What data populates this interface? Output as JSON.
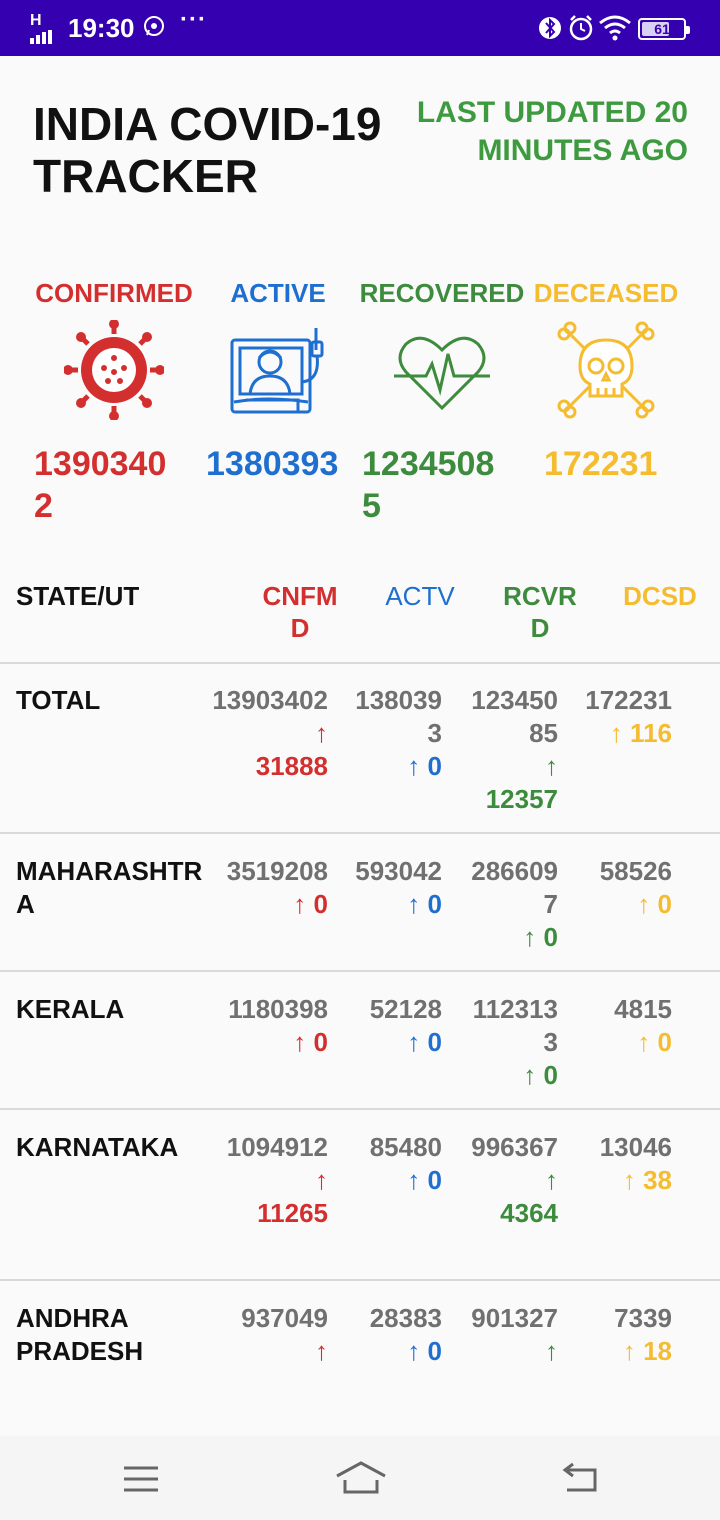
{
  "status_bar": {
    "network": "H",
    "time": "19:30",
    "more": "···",
    "battery": "61"
  },
  "header": {
    "title": "INDIA COVID-19 TRACKER",
    "updated": "LAST UPDATED 20 MINUTES AGO"
  },
  "summary": {
    "confirmed": {
      "label": "CONFIRMED",
      "value": "13903402",
      "icon": "virus-icon"
    },
    "active": {
      "label": "ACTIVE",
      "value": "1380393",
      "icon": "patient-bed-icon"
    },
    "recovered": {
      "label": "RECOVERED",
      "value": "12345085",
      "icon": "heartbeat-icon"
    },
    "deceased": {
      "label": "DECEASED",
      "value": "172231",
      "icon": "skull-crossbones-icon"
    }
  },
  "table": {
    "headers": {
      "state": "STATE/UT",
      "confirmed": "CNFMD",
      "active": "ACTV",
      "recovered": "RCVRD",
      "deceased": "DCSD"
    },
    "rows": [
      {
        "state": "TOTAL",
        "confirmed": "13903402",
        "confirmed_delta": "31888",
        "active": "1380393",
        "active_delta": "0",
        "recovered": "12345085",
        "recovered_delta": "12357",
        "deceased": "172231",
        "deceased_delta": "116"
      },
      {
        "state": "MAHARASHTRA",
        "confirmed": "3519208",
        "confirmed_delta": "0",
        "active": "593042",
        "active_delta": "0",
        "recovered": "2866097",
        "recovered_delta": "0",
        "deceased": "58526",
        "deceased_delta": "0"
      },
      {
        "state": "KERALA",
        "confirmed": "1180398",
        "confirmed_delta": "0",
        "active": "52128",
        "active_delta": "0",
        "recovered": "1123133",
        "recovered_delta": "0",
        "deceased": "4815",
        "deceased_delta": "0"
      },
      {
        "state": "KARNATAKA",
        "confirmed": "1094912",
        "confirmed_delta": "11265",
        "active": "85480",
        "active_delta": "0",
        "recovered": "996367",
        "recovered_delta": "4364",
        "deceased": "13046",
        "deceased_delta": "38"
      },
      {
        "state": "ANDHRA PRADESH",
        "confirmed": "937049",
        "confirmed_delta": "",
        "active": "28383",
        "active_delta": "0",
        "recovered": "901327",
        "recovered_delta": "",
        "deceased": "7339",
        "deceased_delta": "18"
      }
    ]
  },
  "colors": {
    "confirmed": "#d32f2f",
    "active": "#1e6fd0",
    "recovered": "#3d8b3d",
    "deceased": "#f4bc2e",
    "status_bar": "#3400b0"
  }
}
